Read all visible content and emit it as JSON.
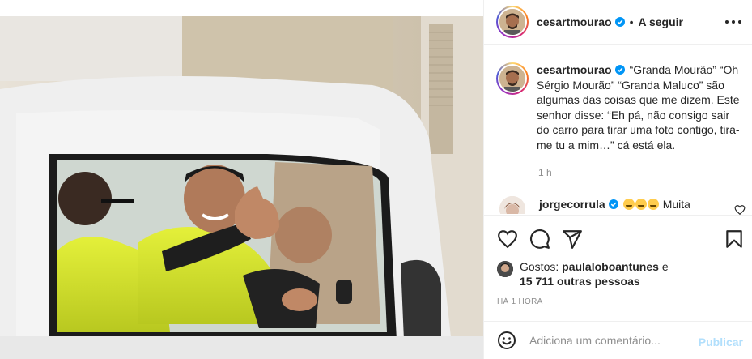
{
  "post": {
    "username": "cesartmourao",
    "follow_separator": "•",
    "follow_label": "A seguir",
    "more_icon": "more-horizontal-icon"
  },
  "caption": {
    "username": "cesartmourao",
    "text": "“Granda Mourão” “Oh Sérgio Mourão” “Granda Maluco” são algumas das coisas que me dizem. Este senhor disse: “Eh pá, não consigo sair do carro para tirar uma foto contigo, tira-me tu a mim…” cá está ela.",
    "time": "1 h"
  },
  "comment": {
    "username": "jorgecorrula",
    "text": "Muita"
  },
  "likes": {
    "prefix": "Gostos:",
    "user": "paulaloboantunes",
    "connector": "e",
    "others": "15 711 outras pessoas"
  },
  "timestamp": "HÁ 1 HORA",
  "add_comment": {
    "placeholder": "Adiciona um comentário...",
    "publish_label": "Publicar"
  },
  "colors": {
    "verified": "#0095f6",
    "publish_disabled": "#b2dffc",
    "secondary_text": "#8e8e8e"
  }
}
